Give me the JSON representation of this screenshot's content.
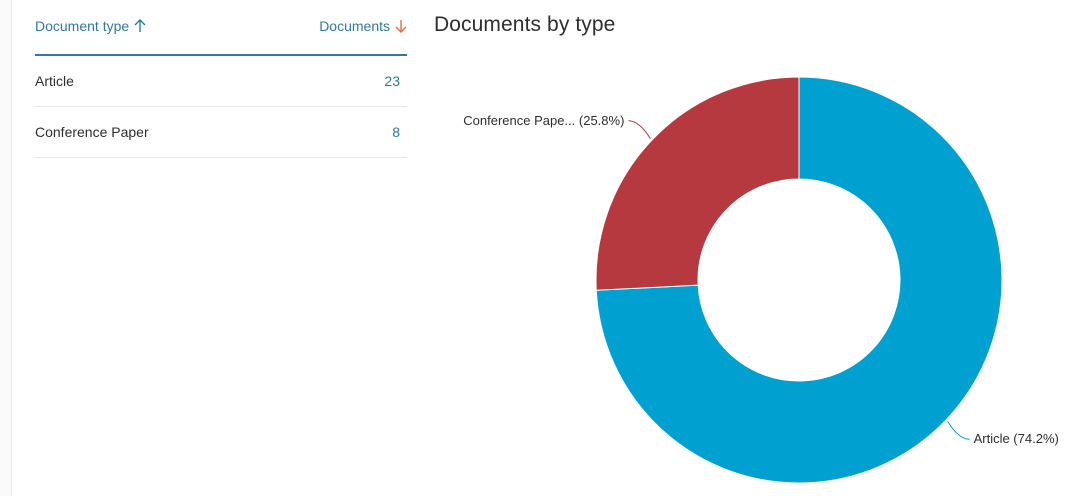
{
  "table": {
    "col_type_label": "Document type",
    "col_docs_label": "Documents",
    "rows": [
      {
        "label": "Article",
        "count": "23"
      },
      {
        "label": "Conference Paper",
        "count": "8"
      }
    ]
  },
  "chart": {
    "title": "Documents by type"
  },
  "chart_data": {
    "type": "pie",
    "title": "Documents by type",
    "donut": true,
    "slices": [
      {
        "name": "Article",
        "value": 23,
        "percent": 74.2,
        "label": "Article (74.2%)",
        "color": "#00a0d1"
      },
      {
        "name": "Conference Paper",
        "value": 8,
        "percent": 25.8,
        "label": "Conference Pape... (25.8%)",
        "color": "#b5393e"
      }
    ]
  },
  "colors": {
    "accent": "#2e7aa1",
    "sort_desc_arrow": "#e8693a"
  }
}
